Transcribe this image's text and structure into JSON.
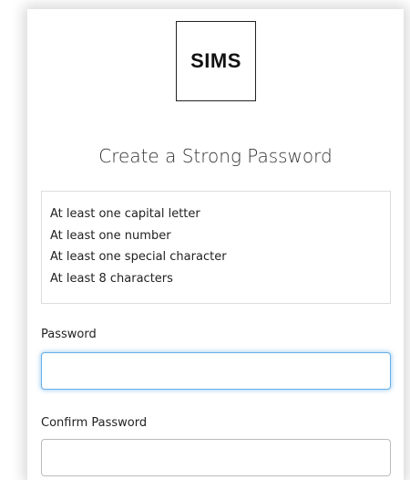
{
  "logo": {
    "text": "SIMS"
  },
  "title": "Create a Strong Password",
  "requirements": [
    "At least one capital letter",
    "At least one number",
    "At least one special character",
    "At least 8 characters"
  ],
  "form": {
    "password_label": "Password",
    "password_value": "",
    "confirm_label": "Confirm Password",
    "confirm_value": ""
  },
  "colors": {
    "focus_border": "#66afe9",
    "input_border": "#bbbbbb",
    "text": "#222222"
  }
}
